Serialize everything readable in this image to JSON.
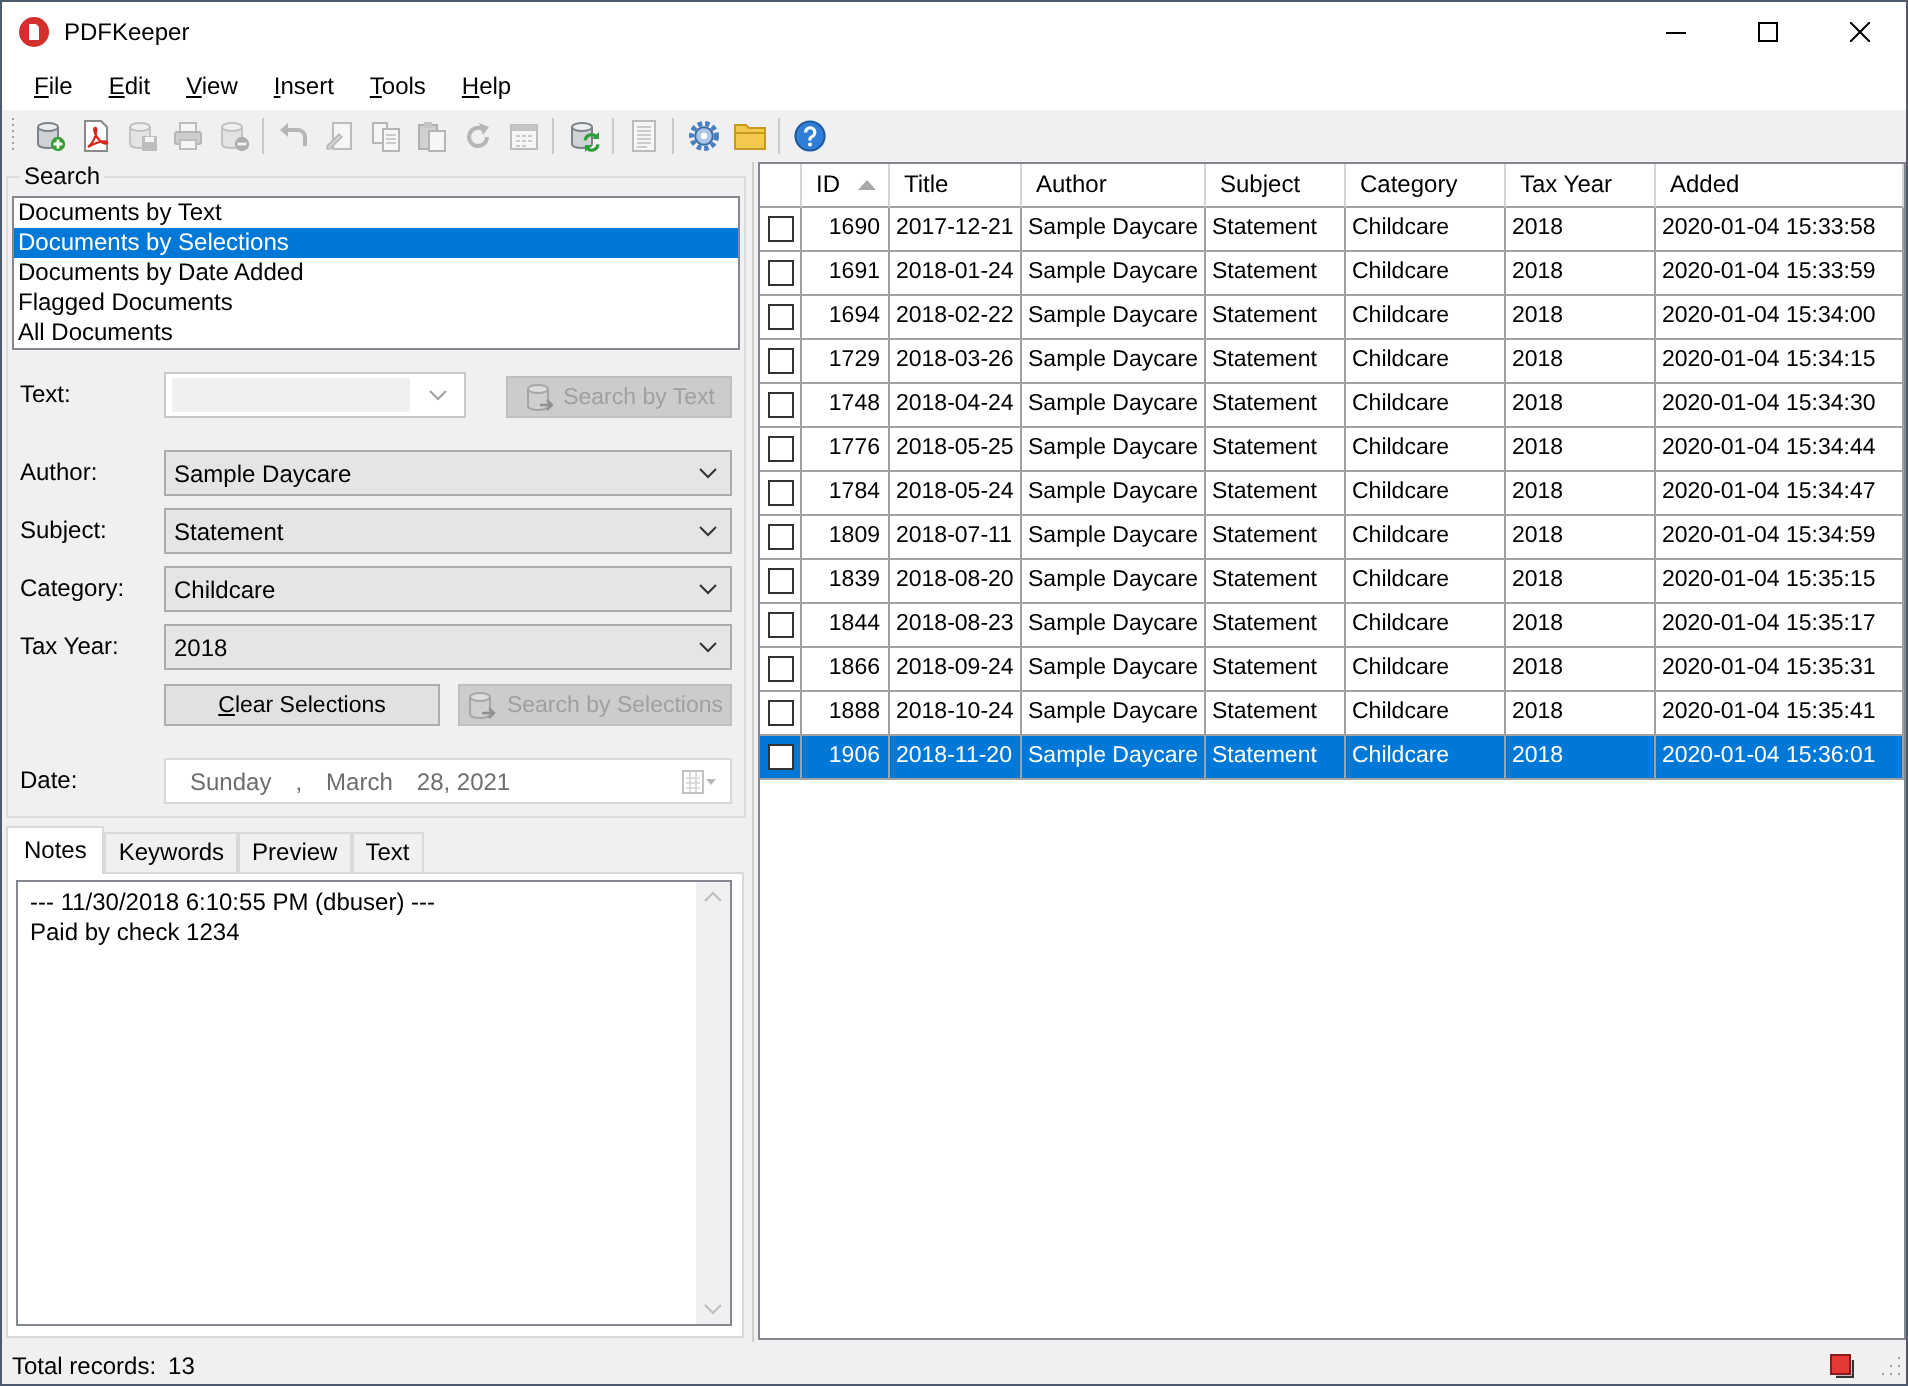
{
  "window": {
    "title": "PDFKeeper"
  },
  "menu": [
    "File",
    "Edit",
    "View",
    "Insert",
    "Tools",
    "Help"
  ],
  "toolbar_groups": [
    {
      "buttons": [
        {
          "kind": "db-add",
          "disabled": false
        },
        {
          "kind": "pdf",
          "disabled": false
        },
        {
          "kind": "db-save",
          "disabled": true
        },
        {
          "kind": "print",
          "disabled": true
        },
        {
          "kind": "db-remove",
          "disabled": true
        }
      ]
    },
    {
      "buttons": [
        {
          "kind": "undo",
          "disabled": true
        },
        {
          "kind": "edit",
          "disabled": true
        },
        {
          "kind": "copy",
          "disabled": true
        },
        {
          "kind": "paste",
          "disabled": true
        },
        {
          "kind": "rotate",
          "disabled": true
        },
        {
          "kind": "calendar",
          "disabled": true
        }
      ]
    },
    {
      "buttons": [
        {
          "kind": "db-refresh",
          "disabled": false
        }
      ]
    },
    {
      "buttons": [
        {
          "kind": "page",
          "disabled": true
        }
      ]
    },
    {
      "buttons": [
        {
          "kind": "gear",
          "disabled": false
        },
        {
          "kind": "folder",
          "disabled": false
        }
      ]
    },
    {
      "buttons": [
        {
          "kind": "help",
          "disabled": false
        }
      ]
    }
  ],
  "search": {
    "title": "Search",
    "modes": [
      {
        "label": "Documents by Text",
        "selected": false
      },
      {
        "label": "Documents by Selections",
        "selected": true
      },
      {
        "label": "Documents by Date Added",
        "selected": false
      },
      {
        "label": "Flagged Documents",
        "selected": false
      },
      {
        "label": "All Documents",
        "selected": false
      }
    ],
    "text": {
      "label": "Text:",
      "button": {
        "label": "Search by Text",
        "kind": "icon-button",
        "disabled": true
      }
    },
    "selections": [
      {
        "label": "Author:",
        "value": "Sample Daycare"
      },
      {
        "label": "Subject:",
        "value": "Statement"
      },
      {
        "label": "Category:",
        "value": "Childcare"
      },
      {
        "label": "Tax Year:",
        "value": "2018"
      }
    ],
    "buttons": [
      {
        "label": "Clear Selections",
        "kind": "text-button",
        "disabled": false
      },
      {
        "label": "Search by Selections",
        "kind": "icon-button",
        "disabled": true
      }
    ],
    "date": {
      "label": "Date:",
      "parts": [
        "Sunday",
        ",",
        "March",
        "28, 2021"
      ],
      "disabled": true
    }
  },
  "tabs": [
    {
      "label": "Notes",
      "selected": true
    },
    {
      "label": "Keywords",
      "selected": false
    },
    {
      "label": "Preview",
      "selected": false
    },
    {
      "label": "Text",
      "selected": false
    }
  ],
  "notes": {
    "lines": [
      "--- 11/30/2018 6:10:55 PM (dbuser) ---",
      "Paid by check 1234"
    ]
  },
  "table": {
    "columns": [
      {
        "label": "ID",
        "sorted": true
      },
      {
        "label": "Title",
        "sorted": false
      },
      {
        "label": "Author",
        "sorted": false
      },
      {
        "label": "Subject",
        "sorted": false
      },
      {
        "label": "Category",
        "sorted": false
      },
      {
        "label": "Tax Year",
        "sorted": false
      },
      {
        "label": "Added",
        "sorted": false
      }
    ],
    "rows": [
      {
        "checked": false,
        "selected": false,
        "cells": [
          "1690",
          "2017-12-21",
          "Sample Daycare",
          "Statement",
          "Childcare",
          "2018",
          "2020-01-04 15:33:58"
        ]
      },
      {
        "checked": false,
        "selected": false,
        "cells": [
          "1691",
          "2018-01-24",
          "Sample Daycare",
          "Statement",
          "Childcare",
          "2018",
          "2020-01-04 15:33:59"
        ]
      },
      {
        "checked": false,
        "selected": false,
        "cells": [
          "1694",
          "2018-02-22",
          "Sample Daycare",
          "Statement",
          "Childcare",
          "2018",
          "2020-01-04 15:34:00"
        ]
      },
      {
        "checked": false,
        "selected": false,
        "cells": [
          "1729",
          "2018-03-26",
          "Sample Daycare",
          "Statement",
          "Childcare",
          "2018",
          "2020-01-04 15:34:15"
        ]
      },
      {
        "checked": false,
        "selected": false,
        "cells": [
          "1748",
          "2018-04-24",
          "Sample Daycare",
          "Statement",
          "Childcare",
          "2018",
          "2020-01-04 15:34:30"
        ]
      },
      {
        "checked": false,
        "selected": false,
        "cells": [
          "1776",
          "2018-05-25",
          "Sample Daycare",
          "Statement",
          "Childcare",
          "2018",
          "2020-01-04 15:34:44"
        ]
      },
      {
        "checked": false,
        "selected": false,
        "cells": [
          "1784",
          "2018-05-24",
          "Sample Daycare",
          "Statement",
          "Childcare",
          "2018",
          "2020-01-04 15:34:47"
        ]
      },
      {
        "checked": false,
        "selected": false,
        "cells": [
          "1809",
          "2018-07-11",
          "Sample Daycare",
          "Statement",
          "Childcare",
          "2018",
          "2020-01-04 15:34:59"
        ]
      },
      {
        "checked": false,
        "selected": false,
        "cells": [
          "1839",
          "2018-08-20",
          "Sample Daycare",
          "Statement",
          "Childcare",
          "2018",
          "2020-01-04 15:35:15"
        ]
      },
      {
        "checked": false,
        "selected": false,
        "cells": [
          "1844",
          "2018-08-23",
          "Sample Daycare",
          "Statement",
          "Childcare",
          "2018",
          "2020-01-04 15:35:17"
        ]
      },
      {
        "checked": false,
        "selected": false,
        "cells": [
          "1866",
          "2018-09-24",
          "Sample Daycare",
          "Statement",
          "Childcare",
          "2018",
          "2020-01-04 15:35:31"
        ]
      },
      {
        "checked": false,
        "selected": false,
        "cells": [
          "1888",
          "2018-10-24",
          "Sample Daycare",
          "Statement",
          "Childcare",
          "2018",
          "2020-01-04 15:35:41"
        ]
      },
      {
        "checked": false,
        "selected": true,
        "cells": [
          "1906",
          "2018-11-20",
          "Sample Daycare",
          "Statement",
          "Childcare",
          "2018",
          "2020-01-04 15:36:01"
        ]
      }
    ]
  },
  "status_bar": {
    "label": "Total records:",
    "count": "13"
  }
}
